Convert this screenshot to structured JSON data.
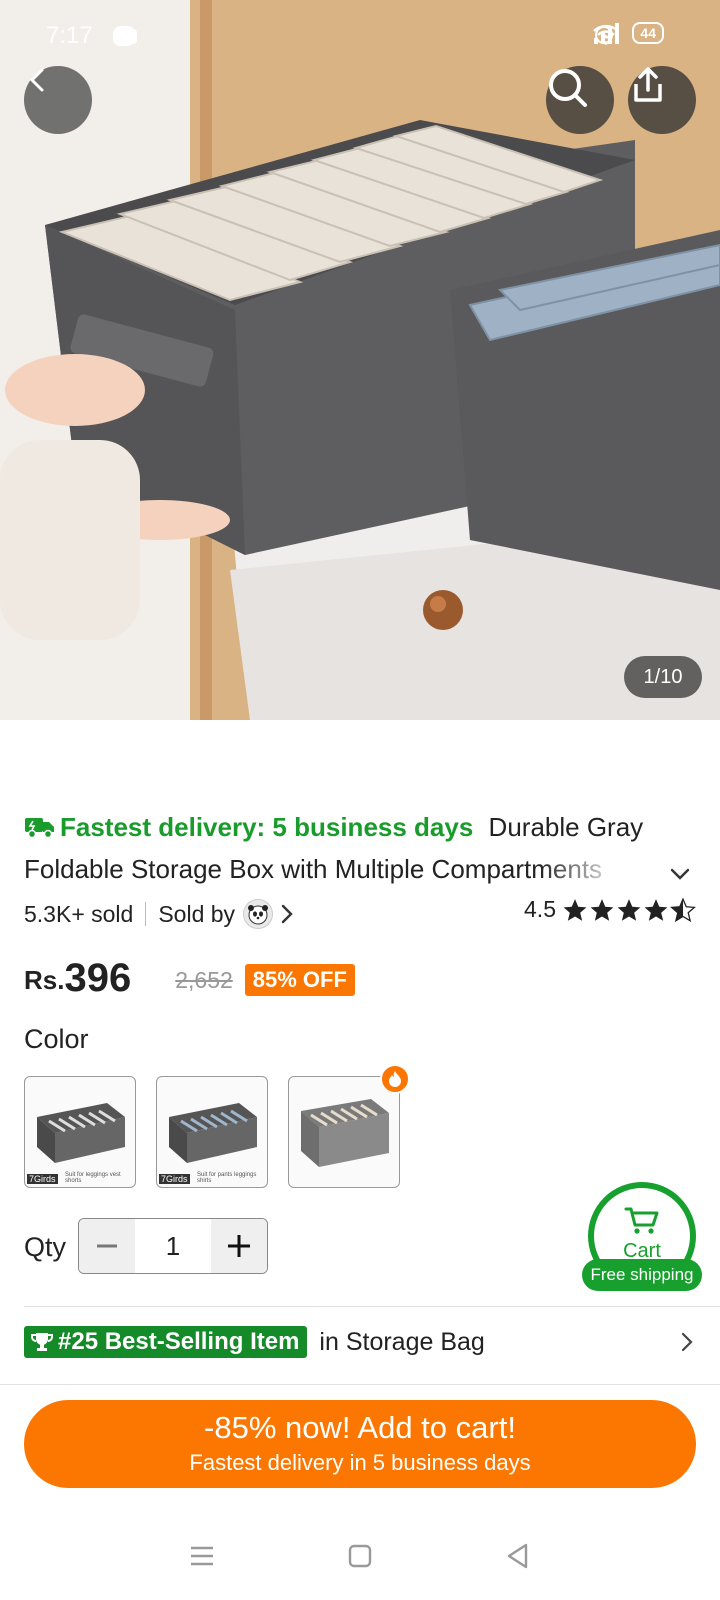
{
  "status_bar": {
    "time": "7:17",
    "battery": "44",
    "left_icons": [
      "messenger-icon",
      "instagram-icon",
      "youtube-icon",
      "snapchat-icon",
      "dot-icon"
    ],
    "right_icons": [
      "alarm-icon",
      "wifi-icon",
      "signal-icon",
      "signal-icon"
    ]
  },
  "gallery": {
    "counter": "1/10"
  },
  "product": {
    "delivery_text": "Fastest delivery: 5 business days",
    "title_part1": "Durable Gray",
    "title_part2": "Foldable Storage Box with Multiple Compartments",
    "sold": "5.3K+ sold",
    "sold_by": "Sold by",
    "rating": "4.5",
    "stars": 4.5,
    "currency": "Rs.",
    "price": "396",
    "old_price": "2,652",
    "discount": "85% OFF"
  },
  "color": {
    "label": "Color",
    "options": [
      {
        "tag": "7Girds",
        "note": "Suit for leggings vest shorts"
      },
      {
        "tag": "7Girds",
        "note": "Suit for pants leggings shirts"
      },
      {
        "tag": "",
        "note": ""
      }
    ]
  },
  "quantity": {
    "label": "Qty",
    "value": "1"
  },
  "cart": {
    "label": "Cart",
    "free_shipping": "Free shipping"
  },
  "best_seller": {
    "badge": "#25 Best-Selling Item",
    "category": "in Storage Bag"
  },
  "cta": {
    "main": "-85% now! Add to cart!",
    "sub": "Fastest delivery in 5 business days"
  },
  "colors": {
    "accent": "#fb7701",
    "green": "#1a9c2c"
  }
}
